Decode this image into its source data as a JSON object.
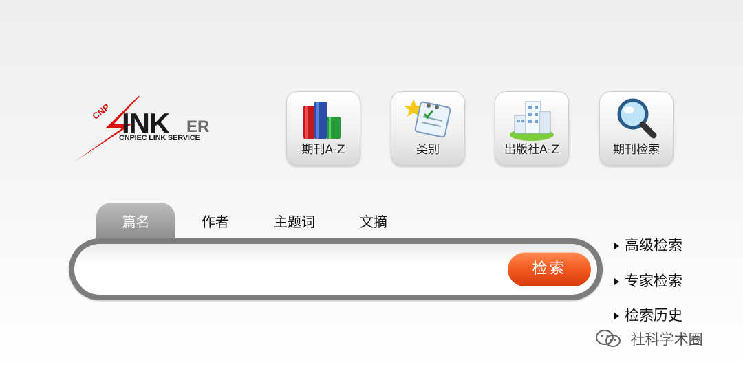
{
  "logo": {
    "prefix": "CNP",
    "brand_main": "INK",
    "brand_suffix": "ER",
    "tagline": "CNPIEC LINK SERVICE",
    "accent_color": "#e01010"
  },
  "nav_tiles": [
    {
      "label": "期刊A-Z",
      "icon": "books-icon"
    },
    {
      "label": "类别",
      "icon": "clipboard-star-icon"
    },
    {
      "label": "出版社A-Z",
      "icon": "building-icon"
    },
    {
      "label": "期刊检索",
      "icon": "magnifier-icon"
    }
  ],
  "search": {
    "tabs": [
      {
        "label": "篇名",
        "active": true
      },
      {
        "label": "作者",
        "active": false
      },
      {
        "label": "主题词",
        "active": false
      },
      {
        "label": "文摘",
        "active": false
      }
    ],
    "input_value": "",
    "button_label": "检索",
    "button_color": "#f25a1f"
  },
  "side_links": [
    "高级检索",
    "专家检索",
    "检索历史"
  ],
  "watermark": {
    "text": "社科学术圈",
    "icon": "wechat-icon"
  }
}
